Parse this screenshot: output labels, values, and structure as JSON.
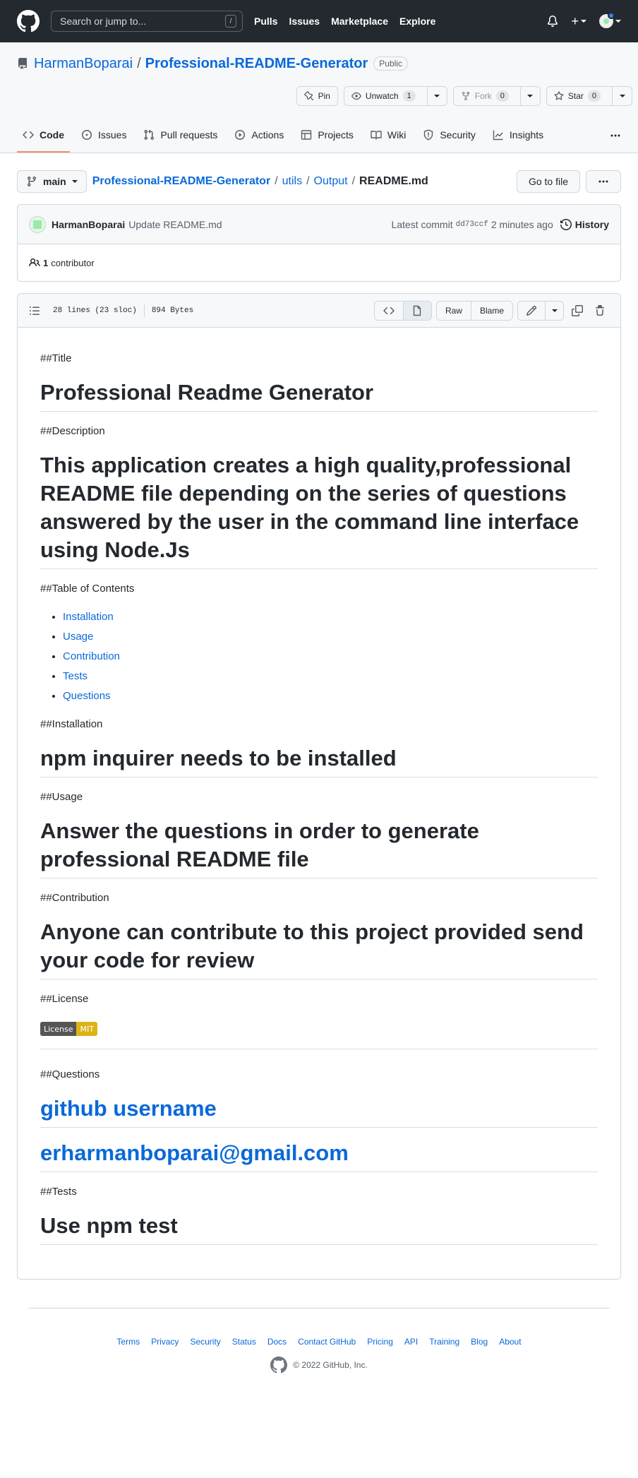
{
  "header": {
    "search_placeholder": "Search or jump to...",
    "search_key": "/",
    "nav": [
      "Pulls",
      "Issues",
      "Marketplace",
      "Explore"
    ]
  },
  "repo": {
    "owner": "HarmanBoparai",
    "separator": "/",
    "name": "Professional-README-Generator",
    "visibility": "Public",
    "pin_label": "Pin",
    "watch_label": "Unwatch",
    "watch_count": "1",
    "fork_label": "Fork",
    "fork_count": "0",
    "star_label": "Star",
    "star_count": "0"
  },
  "tabs": [
    {
      "label": "Code",
      "icon": "code-icon"
    },
    {
      "label": "Issues",
      "icon": "issue-icon"
    },
    {
      "label": "Pull requests",
      "icon": "pull-request-icon"
    },
    {
      "label": "Actions",
      "icon": "play-icon"
    },
    {
      "label": "Projects",
      "icon": "table-icon"
    },
    {
      "label": "Wiki",
      "icon": "book-icon"
    },
    {
      "label": "Security",
      "icon": "shield-icon"
    },
    {
      "label": "Insights",
      "icon": "graph-icon"
    }
  ],
  "breadcrumb": {
    "branch": "main",
    "root": "Professional-README-Generator",
    "path1": "utils",
    "path2": "Output",
    "file": "README.md",
    "go_to_file": "Go to file"
  },
  "commit": {
    "author": "HarmanBoparai",
    "message": "Update README.md",
    "latest_label": "Latest commit",
    "hash": "dd73ccf",
    "time": "2 minutes ago",
    "history_label": "History",
    "contributors_count": "1",
    "contributors_label": "contributor"
  },
  "file": {
    "lines": "28 lines (23 sloc)",
    "size": "894 Bytes",
    "raw_label": "Raw",
    "blame_label": "Blame"
  },
  "readme": {
    "title_marker": "##Title",
    "title": "Professional Readme Generator",
    "desc_marker": "##Description",
    "description": "This application creates a high quality,professional README file depending on the series of questions answered by the user in the command line interface using Node.Js",
    "toc_marker": "##Table of Contents",
    "toc": [
      "Installation",
      "Usage",
      "Contribution",
      "Tests",
      "Questions"
    ],
    "install_marker": "##Installation",
    "install": "npm inquirer needs to be installed",
    "usage_marker": "##Usage",
    "usage": "Answer the questions in order to generate professional README file",
    "contrib_marker": "##Contribution",
    "contrib": "Anyone can contribute to this project provided send your code for review",
    "license_marker": "##License",
    "license_badge_left": "License",
    "license_badge_right": "MIT",
    "questions_marker": "##Questions",
    "github_link": "github username",
    "email_link": "erharmanboparai@gmail.com",
    "tests_marker": "##Tests",
    "tests": "Use npm test"
  },
  "footer": {
    "links": [
      "Terms",
      "Privacy",
      "Security",
      "Status",
      "Docs",
      "Contact GitHub",
      "Pricing",
      "API",
      "Training",
      "Blog",
      "About"
    ],
    "copyright": "© 2022 GitHub, Inc."
  }
}
